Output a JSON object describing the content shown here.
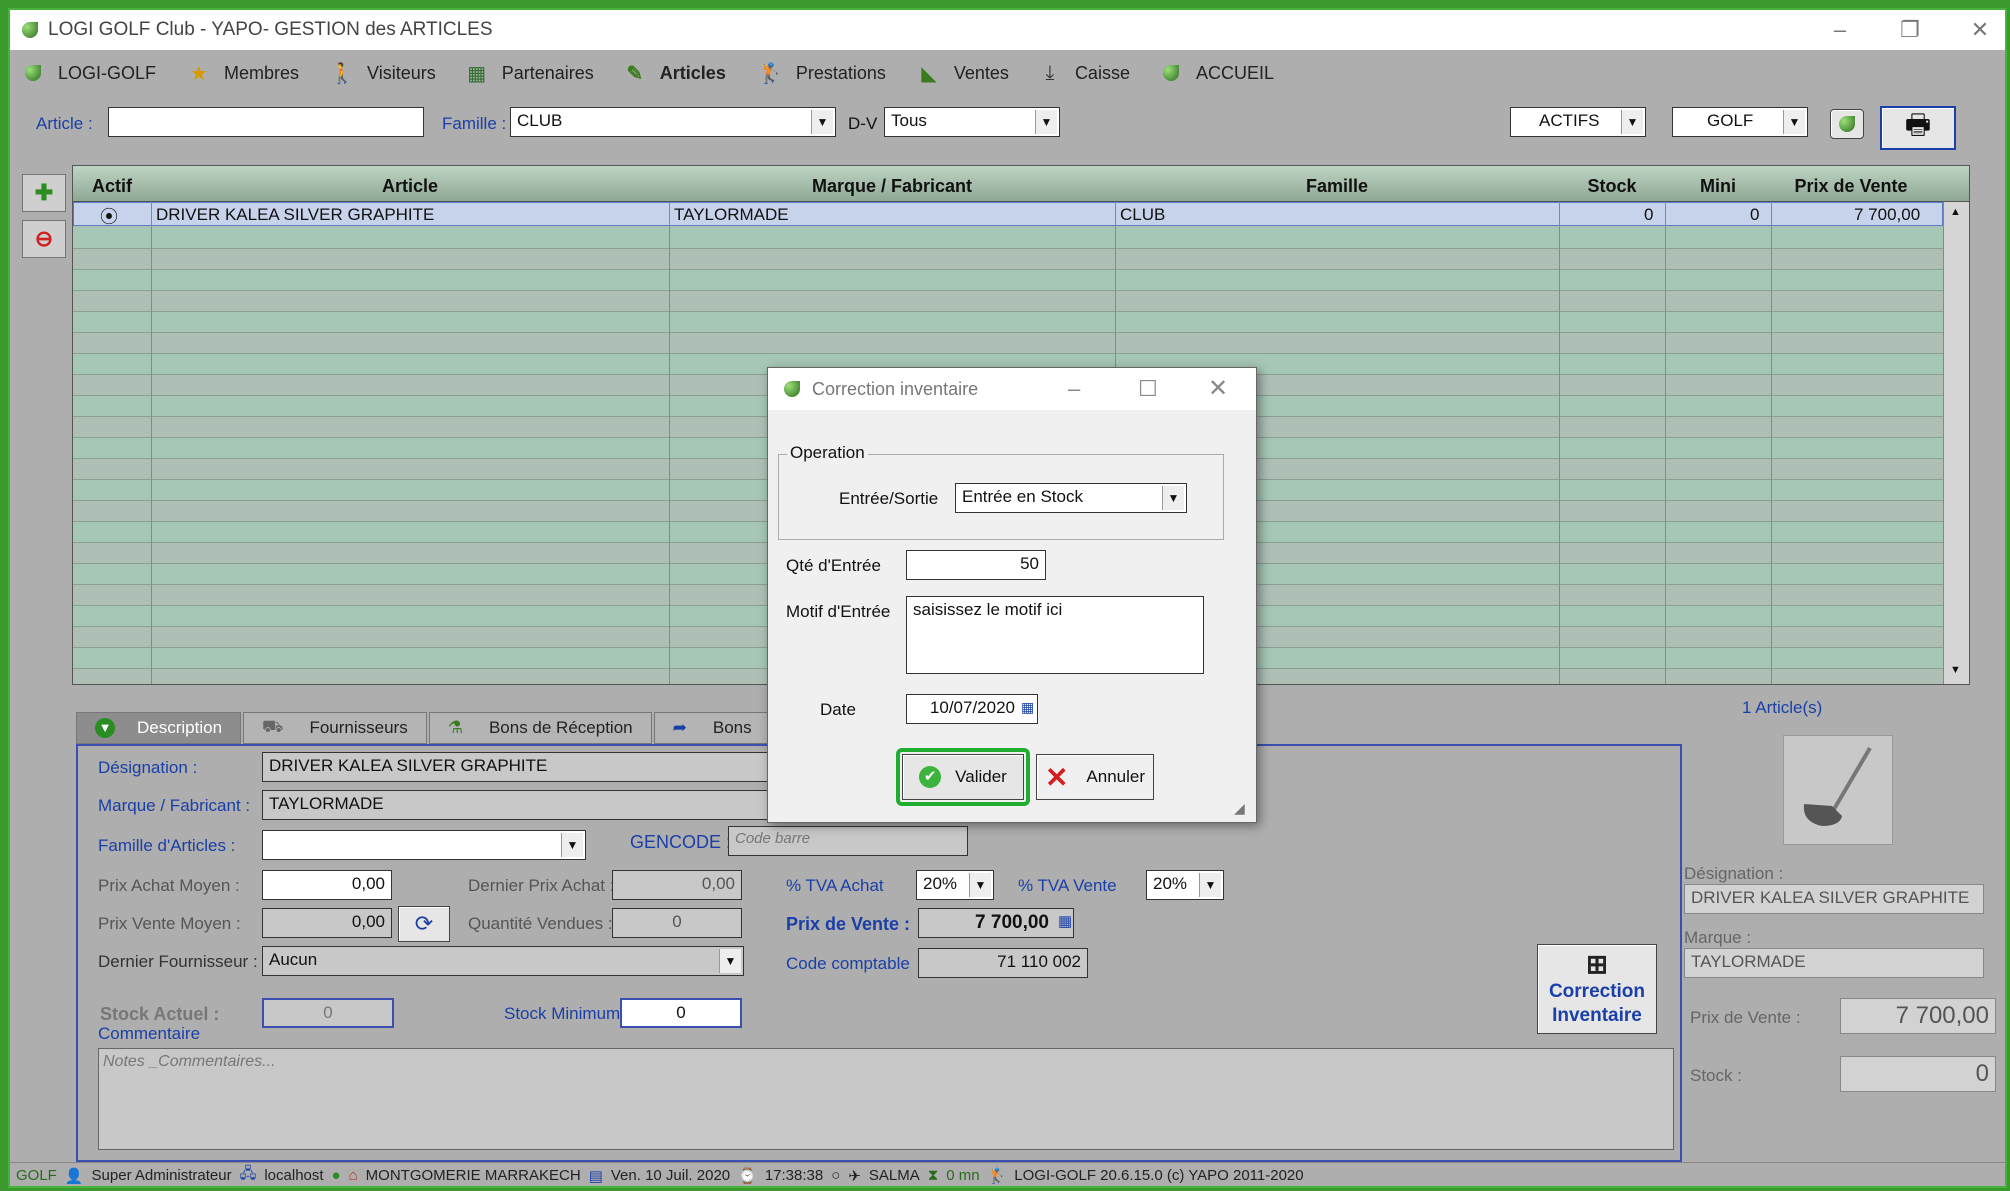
{
  "window": {
    "title": "LOGI GOLF Club - YAPO- GESTION des ARTICLES"
  },
  "menu": [
    {
      "label": "LOGI-GOLF",
      "icon": "leaf-icon"
    },
    {
      "label": "Membres",
      "icon": "star-icon"
    },
    {
      "label": "Visiteurs",
      "icon": "walker-icon"
    },
    {
      "label": "Partenaires",
      "icon": "partners-icon"
    },
    {
      "label": "Articles",
      "icon": "pen-icon"
    },
    {
      "label": "Prestations",
      "icon": "golfer-icon"
    },
    {
      "label": "Ventes",
      "icon": "cart-icon"
    },
    {
      "label": "Caisse",
      "icon": "download-icon"
    },
    {
      "label": "ACCUEIL",
      "icon": "leaf-icon"
    }
  ],
  "filters": {
    "article_label": "Article :",
    "article_value": "",
    "famille_label": "Famille :",
    "famille_value": "CLUB",
    "dv_label": "D-V",
    "dv_value": "Tous",
    "actifs_value": "ACTIFS",
    "golf_value": "GOLF"
  },
  "grid": {
    "headers": [
      "Actif",
      "Article",
      "Marque / Fabricant",
      "Famille",
      "Stock",
      "Mini",
      "Prix de Vente"
    ],
    "rows": [
      {
        "article": "DRIVER KALEA SILVER GRAPHITE",
        "marque": "TAYLORMADE",
        "famille": "CLUB",
        "stock": "0",
        "mini": "0",
        "prix": "7 700,00"
      }
    ]
  },
  "tabs": [
    "Description",
    "Fournisseurs",
    "Bons de Réception",
    "Bons"
  ],
  "form": {
    "designation_label": "Désignation :",
    "designation": "DRIVER KALEA SILVER GRAPHITE",
    "marque_label": "Marque / Fabricant :",
    "marque": "TAYLORMADE",
    "famille_label": "Famille d'Articles :",
    "famille": "",
    "gencode_label": "GENCODE :",
    "gencode_placeholder": "Code barre",
    "prix_achat_moyen_label": "Prix Achat Moyen :",
    "prix_achat_moyen": "0,00",
    "dernier_prix_achat_label": "Dernier Prix Achat :",
    "dernier_prix_achat": "0,00",
    "tva_achat_label": "% TVA  Achat",
    "tva_achat": "20%",
    "tva_vente_label": "% TVA  Vente",
    "tva_vente": "20%",
    "prix_vente_moyen_label": "Prix Vente Moyen :",
    "prix_vente_moyen": "0,00",
    "qte_vendues_label": "Quantité Vendues :",
    "qte_vendues": "0",
    "prix_vente_label": "Prix de Vente :",
    "prix_vente": "7 700,00",
    "dernier_fournisseur_label": "Dernier Fournisseur :",
    "dernier_fournisseur": "Aucun",
    "code_comptable_label": "Code comptable",
    "code_comptable": "71 110 002",
    "stock_actuel_label": "Stock Actuel :",
    "stock_actuel": "0",
    "stock_minimum_label": "Stock Minimum :",
    "stock_minimum": "0",
    "commentaire_label": "Commentaire",
    "notes_placeholder": "Notes _Commentaires..."
  },
  "correction_button": "Correction Inventaire",
  "side": {
    "count": "1 Article(s)",
    "designation_label": "Désignation :",
    "designation": "DRIVER KALEA SILVER GRAPHITE",
    "marque_label": "Marque :",
    "marque": "TAYLORMADE",
    "prix_label": "Prix de Vente :",
    "prix": "7 700,00",
    "stock_label": "Stock :",
    "stock": "0"
  },
  "dialog": {
    "title": "Correction inventaire",
    "group": "Operation",
    "es_label": "Entrée/Sortie",
    "es_value": "Entrée en Stock",
    "qte_label": "Qté d'Entrée",
    "qte_value": "50",
    "motif_label": "Motif d'Entrée",
    "motif_value": "saisissez le motif ici",
    "date_label": "Date",
    "date_value": "10/07/2020",
    "valider": "Valider",
    "annuler": "Annuler"
  },
  "status": {
    "site": "GOLF",
    "user": "Super Administrateur",
    "host": "localhost",
    "club": "MONTGOMERIE MARRAKECH",
    "date": "Ven. 10 Juil. 2020",
    "time": "17:38:38",
    "operator": "SALMA",
    "duration": "0 mn",
    "version": "LOGI-GOLF 20.6.15.0  (c) YAPO 2011-2020"
  },
  "colors": {
    "frame": "#46b43a",
    "highlight": "#1fae2f",
    "label": "#1a3fa8"
  }
}
